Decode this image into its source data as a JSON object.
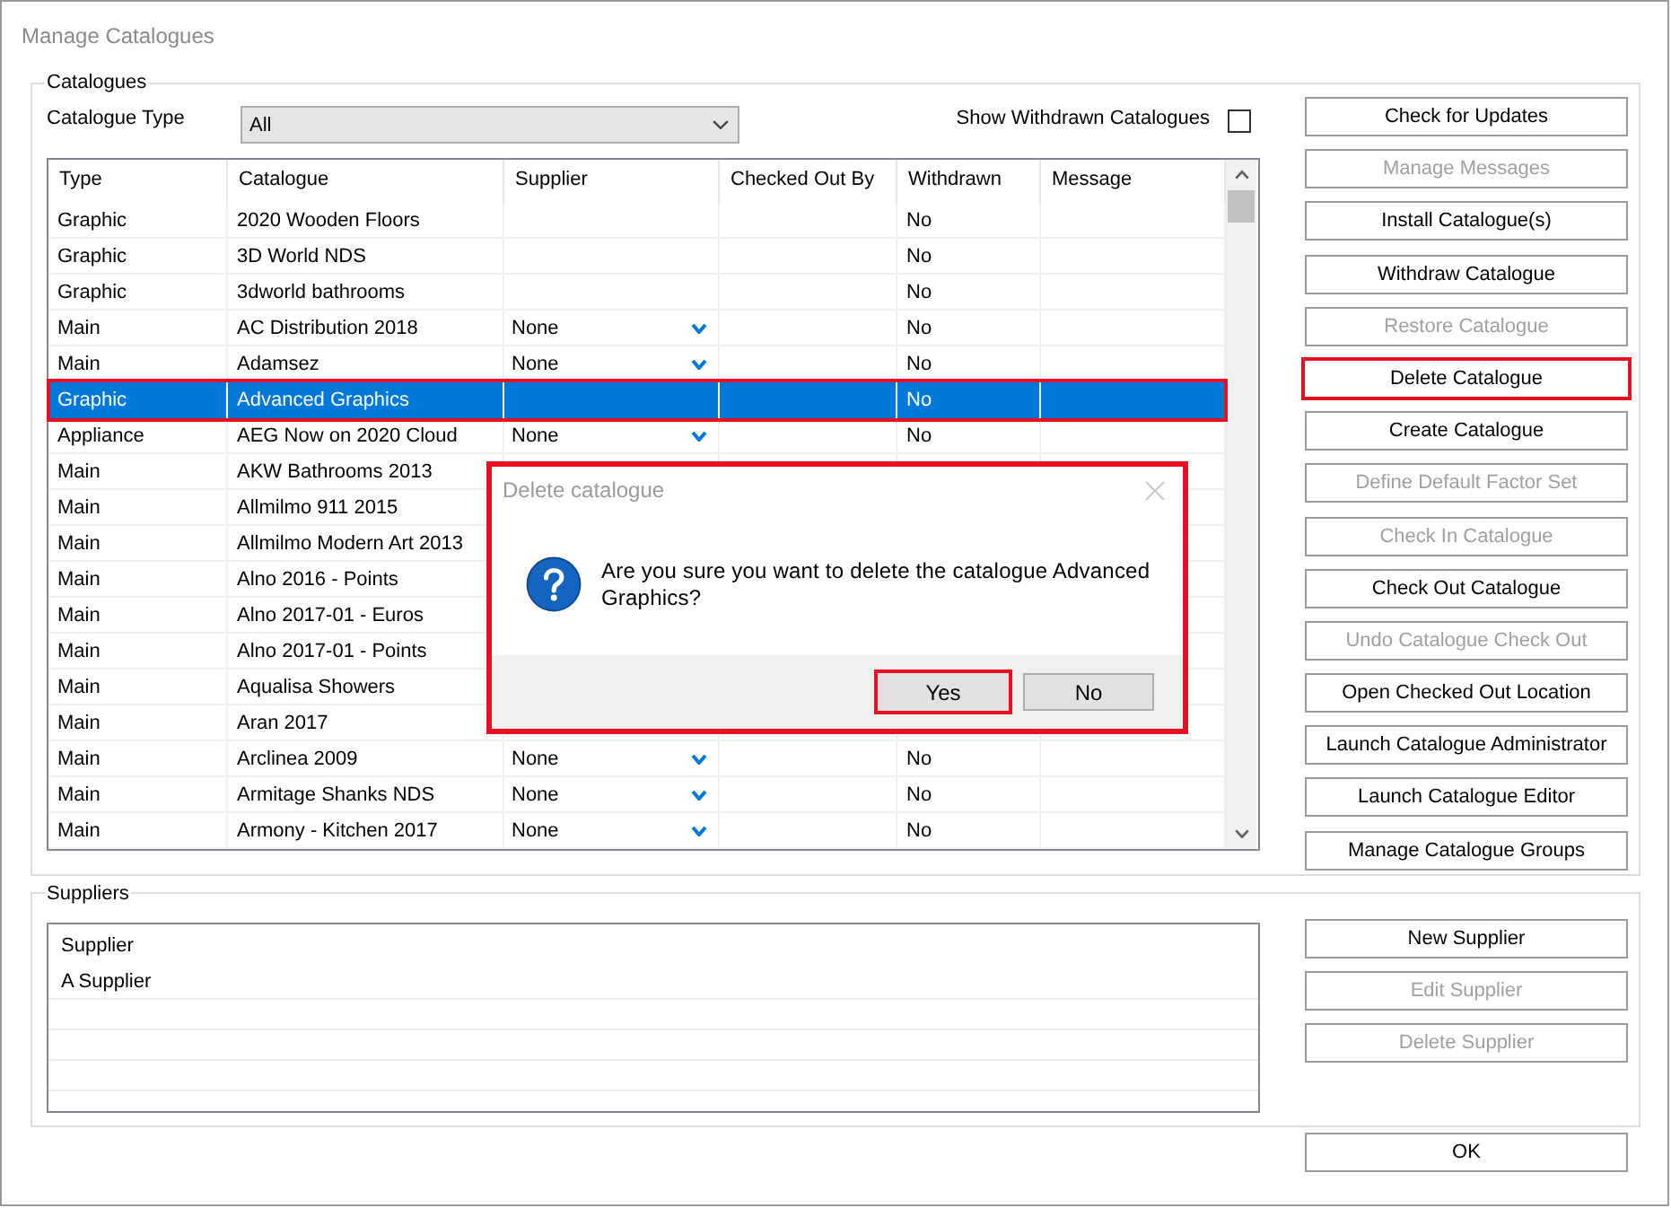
{
  "window": {
    "title": "Manage Catalogues"
  },
  "catalogues": {
    "legend": "Catalogues",
    "type_filter": {
      "label": "Catalogue Type",
      "value": "All"
    },
    "show_withdrawn": {
      "label": "Show Withdrawn Catalogues",
      "checked": false
    },
    "table": {
      "columns": [
        "Type",
        "Catalogue",
        "Supplier",
        "Checked Out By",
        "Withdrawn",
        "Message"
      ],
      "rows": [
        {
          "type": "Graphic",
          "catalogue": "2020 Wooden Floors",
          "withdrawn": "No",
          "selected": false,
          "highlighted": false
        },
        {
          "type": "Graphic",
          "catalogue": "3D World NDS",
          "withdrawn": "No",
          "selected": false,
          "highlighted": false
        },
        {
          "type": "Graphic",
          "catalogue": "3dworld bathrooms",
          "withdrawn": "No",
          "selected": false,
          "highlighted": false
        },
        {
          "type": "Main",
          "catalogue": "AC Distribution 2018",
          "supplier": "None",
          "withdrawn": "No",
          "selected": false,
          "highlighted": false
        },
        {
          "type": "Main",
          "catalogue": "Adamsez",
          "supplier": "None",
          "withdrawn": "No",
          "selected": false,
          "highlighted": false
        },
        {
          "type": "Graphic",
          "catalogue": "Advanced Graphics",
          "withdrawn": "No",
          "selected": true,
          "highlighted": true
        },
        {
          "type": "Appliance",
          "catalogue": "AEG Now on 2020 Cloud",
          "supplier": "None",
          "withdrawn": "No",
          "selected": false,
          "highlighted": false
        },
        {
          "type": "Main",
          "catalogue": "AKW Bathrooms 2013",
          "selected": false,
          "highlighted": false
        },
        {
          "type": "Main",
          "catalogue": "Allmilmo 911 2015",
          "selected": false,
          "highlighted": false
        },
        {
          "type": "Main",
          "catalogue": "Allmilmo Modern Art 2013",
          "selected": false,
          "highlighted": false
        },
        {
          "type": "Main",
          "catalogue": "Alno 2016 - Points",
          "selected": false,
          "highlighted": false
        },
        {
          "type": "Main",
          "catalogue": "Alno 2017-01 - Euros",
          "selected": false,
          "highlighted": false
        },
        {
          "type": "Main",
          "catalogue": "Alno 2017-01 - Points",
          "selected": false,
          "highlighted": false
        },
        {
          "type": "Main",
          "catalogue": "Aqualisa Showers",
          "selected": false,
          "highlighted": false
        },
        {
          "type": "Main",
          "catalogue": "Aran 2017",
          "selected": false,
          "highlighted": false
        },
        {
          "type": "Main",
          "catalogue": "Arclinea 2009",
          "supplier": "None",
          "withdrawn": "No",
          "selected": false,
          "highlighted": false
        },
        {
          "type": "Main",
          "catalogue": "Armitage Shanks NDS",
          "supplier": "None",
          "withdrawn": "No",
          "selected": false,
          "highlighted": false
        },
        {
          "type": "Main",
          "catalogue": "Armony - Kitchen 2017",
          "supplier": "None",
          "withdrawn": "No",
          "selected": false,
          "highlighted": false
        }
      ]
    },
    "buttons": [
      {
        "label": "Check for Updates",
        "disabled": false,
        "highlighted": false
      },
      {
        "label": "Manage Messages",
        "disabled": true,
        "highlighted": false
      },
      {
        "label": "Install Catalogue(s)",
        "disabled": false,
        "highlighted": false
      },
      {
        "label": "Withdraw Catalogue",
        "disabled": false,
        "highlighted": false
      },
      {
        "label": "Restore Catalogue",
        "disabled": true,
        "highlighted": false
      },
      {
        "label": "Delete Catalogue",
        "disabled": false,
        "highlighted": true
      },
      {
        "label": "Create Catalogue",
        "disabled": false,
        "highlighted": false
      },
      {
        "label": "Define Default Factor Set",
        "disabled": true,
        "highlighted": false
      },
      {
        "label": "Check In Catalogue",
        "disabled": true,
        "highlighted": false
      },
      {
        "label": "Check Out Catalogue",
        "disabled": false,
        "highlighted": false
      },
      {
        "label": "Undo Catalogue Check Out",
        "disabled": true,
        "highlighted": false
      },
      {
        "label": "Open Checked Out Location",
        "disabled": false,
        "highlighted": false
      },
      {
        "label": "Launch Catalogue Administrator",
        "disabled": false,
        "highlighted": false
      },
      {
        "label": "Launch Catalogue Editor",
        "disabled": false,
        "highlighted": false
      },
      {
        "label": "Manage Catalogue Groups",
        "disabled": false,
        "highlighted": false
      }
    ]
  },
  "suppliers": {
    "legend": "Suppliers",
    "list": {
      "column": "Supplier",
      "rows": [
        "A Supplier"
      ]
    },
    "buttons": [
      {
        "label": "New Supplier",
        "disabled": false
      },
      {
        "label": "Edit Supplier",
        "disabled": true
      },
      {
        "label": "Delete Supplier",
        "disabled": true
      }
    ]
  },
  "ok_button": {
    "label": "OK"
  },
  "dialog": {
    "title": "Delete catalogue",
    "message": "Are you sure you want to delete the catalogue Advanced Graphics?",
    "highlighted": true,
    "buttons": [
      {
        "label": "Yes",
        "highlighted": true
      },
      {
        "label": "No",
        "highlighted": false
      }
    ]
  }
}
